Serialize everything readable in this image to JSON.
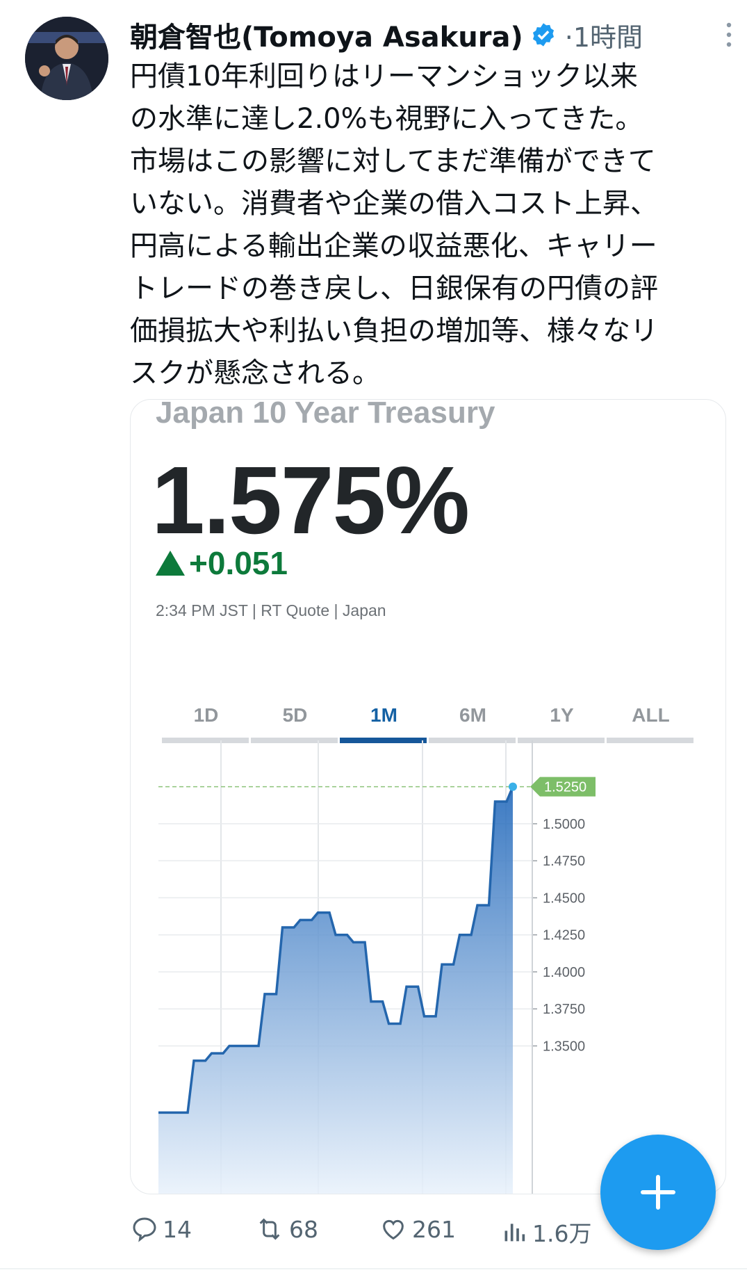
{
  "tweet": {
    "author_name": "朝倉智也(Tomoya Asakura)",
    "timestamp": "·1時間",
    "text_lines": [
      "円債10年利回りはリーマンショック以来",
      "の水準に達し2.0%も視野に入ってきた。",
      "市場はこの影響に対してまだ準備ができて",
      "いない。消費者や企業の借入コスト上昇、",
      "円高による輸出企業の収益悪化、キャリー",
      "トレードの巻き戻し、日銀保有の円債の評",
      "価損拡大や利払い負担の増加等、様々なリ",
      "スクが懸念される。"
    ]
  },
  "quote": {
    "title": "Japan 10 Year Treasury",
    "price": "1.575%",
    "change": "+0.051",
    "meta": "2:34 PM JST | RT Quote | Japan",
    "tabs": [
      "1D",
      "5D",
      "1M",
      "6M",
      "1Y",
      "ALL"
    ],
    "active_tab": "1M"
  },
  "chart_data": {
    "type": "area",
    "title": "",
    "ylim": [
      1.3,
      1.53
    ],
    "y_ticks": [
      "1.5000",
      "1.4750",
      "1.4500",
      "1.4250",
      "1.4000",
      "1.3750",
      "1.3500"
    ],
    "last_value_label": "1.5250",
    "values": [
      1.305,
      1.305,
      1.34,
      1.345,
      1.35,
      1.35,
      1.385,
      1.43,
      1.435,
      1.44,
      1.425,
      1.42,
      1.38,
      1.365,
      1.39,
      1.37,
      1.405,
      1.425,
      1.445,
      1.515,
      1.525
    ],
    "colors": {
      "line": "#2466ad",
      "fill_top": "#1a63b8",
      "fill_bottom": "#e8f1fb",
      "label_bg": "#7dbe68"
    }
  },
  "actions": {
    "replies": "14",
    "retweets": "68",
    "likes": "261",
    "views": "1.6万"
  },
  "icons": [
    "verified-badge-icon",
    "more-icon",
    "reply-icon",
    "retweet-icon",
    "like-icon",
    "views-icon",
    "plus-icon"
  ]
}
